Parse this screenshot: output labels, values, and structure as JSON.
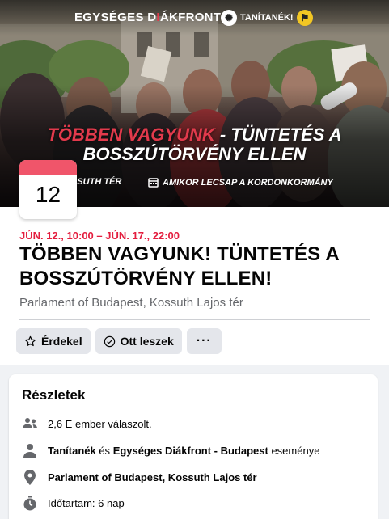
{
  "cover": {
    "org_logo_pre": "EGYSÉGES D",
    "org_logo_accent": "I",
    "org_logo_post": "ÁKFRONT",
    "partner_logo": "TANÍTANÉK!",
    "headline_red": "TÖBBEN VAGYUNK",
    "headline_rest": " - TÜNTETÉS A",
    "headline_line2": "BOSSZÚTÖRVÉNY ELLEN",
    "location_short": "SSUTH TÉR",
    "when_text": "AMIKOR LECSAP A KORDONKORMÁNY"
  },
  "date_badge": {
    "day": "12"
  },
  "event": {
    "date_range": "JÚN. 12., 10:00 – JÚN. 17., 22:00",
    "title": "TÖBBEN VAGYUNK! TÜNTETÉS A BOSSZÚTÖRVÉNY ELLEN!",
    "place": "Parlament of Budapest, Kossuth Lajos tér"
  },
  "actions": {
    "interested": "Érdekel",
    "going": "Ott leszek",
    "more": "···"
  },
  "details": {
    "heading": "Részletek",
    "responses": "2,6 E ember válaszolt.",
    "host_1": "Tanítanék",
    "host_and": " és ",
    "host_2": "Egységes Diákfront - Budapest",
    "host_suffix": " eseménye",
    "location": "Parlament of Budapest, Kossuth Lajos tér",
    "duration": "Időtartam: 6 nap"
  },
  "colors": {
    "accent_red": "#e41e3f",
    "badge_strip": "#f0556a",
    "button_bg": "#e4e6eb",
    "secondary_text": "#65676b"
  }
}
